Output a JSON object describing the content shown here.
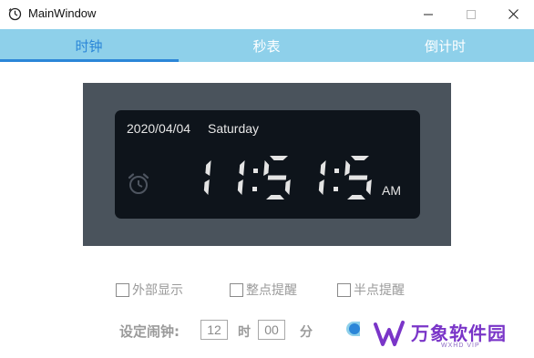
{
  "window": {
    "title": "MainWindow"
  },
  "tabs": [
    {
      "label": "时钟",
      "selected": true
    },
    {
      "label": "秒表",
      "selected": false
    },
    {
      "label": "倒计时",
      "selected": false
    }
  ],
  "clock": {
    "date": "2020/04/04",
    "weekday": "Saturday",
    "time": "11:51:57",
    "ampm": "AM"
  },
  "options": [
    {
      "label": "外部显示",
      "checked": false
    },
    {
      "label": "整点提醒",
      "checked": false
    },
    {
      "label": "半点提醒",
      "checked": false
    }
  ],
  "alarm": {
    "label": "设定闹钟:",
    "hour_value": "12",
    "hour_unit": "时",
    "minute_value": "00",
    "minute_unit": "分"
  },
  "watermark": {
    "text": "万象软件园",
    "subtext": "WXHD VIP"
  },
  "colors": {
    "tab_bar": "#8ed0ea",
    "tab_selected": "#2b86d8",
    "clock_frame": "#4a535c",
    "clock_panel": "#0e141b",
    "digit": "#e4e4e4",
    "watermark": "#7a35c8"
  },
  "icons": {
    "app": "clock-icon",
    "alarm": "alarm-clock-icon",
    "minimize": "minimize-icon",
    "maximize": "maximize-icon",
    "close": "close-icon"
  }
}
